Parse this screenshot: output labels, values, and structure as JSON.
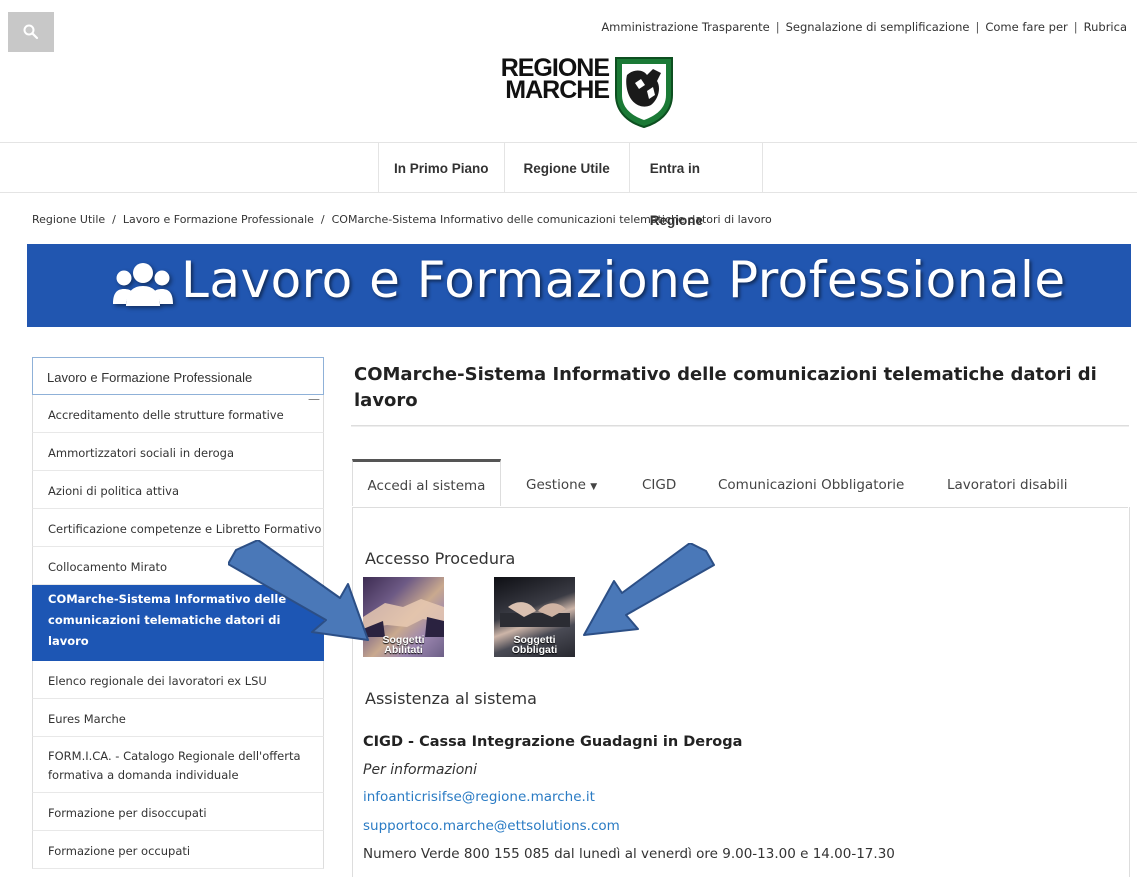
{
  "top_links": [
    "Amministrazione Trasparente",
    "Segnalazione di semplificazione",
    "Come fare per",
    "Rubrica"
  ],
  "logo": {
    "line1": "REGIONE",
    "line2": "MARCHE"
  },
  "nav": [
    "In Primo Piano",
    "Regione Utile",
    "Entra in Regione"
  ],
  "breadcrumb": [
    "Regione Utile",
    "Lavoro e Formazione Professionale",
    "COMarche-Sistema Informativo delle comunicazioni telematiche datori di lavoro"
  ],
  "banner_title": "Lavoro e Formazione Professionale",
  "sidebar": {
    "header": "Lavoro e Formazione Professionale",
    "items": [
      "Accreditamento delle strutture formative",
      "Ammortizzatori sociali in deroga",
      "Azioni di politica attiva",
      "Certificazione competenze e Libretto Formativo",
      "Collocamento Mirato",
      "COMarche-Sistema Informativo delle comunicazioni telematiche datori di lavoro",
      "Elenco regionale dei lavoratori ex LSU",
      "Eures Marche",
      "FORM.I.CA. - Catalogo Regionale dell'offerta formativa a domanda individuale",
      "Formazione per disoccupati",
      "Formazione per occupati"
    ]
  },
  "page_title": "COMarche-Sistema Informativo delle comunicazioni telematiche datori di lavoro",
  "tabs": [
    "Accedi al sistema",
    "Gestione",
    "CIGD",
    "Comunicazioni Obbligatorie",
    "Lavoratori disabili"
  ],
  "accesso": {
    "title": "Accesso Procedura",
    "tile1": {
      "l1": "Soggetti",
      "l2": "Abilitati"
    },
    "tile2": {
      "l1": "Soggetti",
      "l2": "Obbligati"
    }
  },
  "assistenza": {
    "title": "Assistenza al sistema",
    "cigd_title": "CIGD - Cassa Integrazione Guadagni in Deroga",
    "per_info": "Per informazioni",
    "email1": "infoanticrisifse@regione.marche.it",
    "email2": "supportoco.marche@ettsolutions.com",
    "numero_verde": "Numero Verde 800 155 085 dal lunedì al venerdì ore 9.00-13.00 e 14.00-17.30"
  },
  "colors": {
    "banner": "#2156b0",
    "active_side": "#1d56b4",
    "link": "#2a7bc4",
    "arrow": "#4a78b8"
  }
}
